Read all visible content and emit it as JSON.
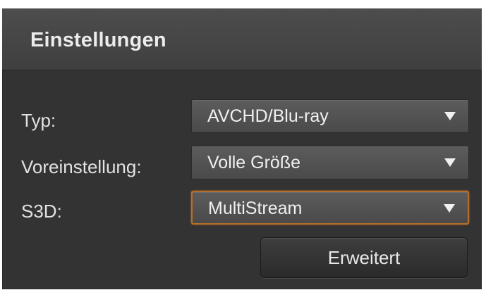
{
  "panel": {
    "title": "Einstellungen"
  },
  "fields": [
    {
      "label": "Typ:",
      "value": "AVCHD/Blu-ray",
      "icon": "chevron-down-icon"
    },
    {
      "label": "Voreinstellung:",
      "value": "Volle Größe",
      "icon": "chevron-down-icon"
    },
    {
      "label": "S3D:",
      "value": "MultiStream",
      "icon": "chevron-down-icon"
    }
  ],
  "buttons": {
    "advanced_label": "Erweitert"
  },
  "colors": {
    "panel_background": "#333333",
    "header_background": "#4d4d4d",
    "focus_accent": "#b56d2a",
    "text": "#e2e2e2"
  }
}
